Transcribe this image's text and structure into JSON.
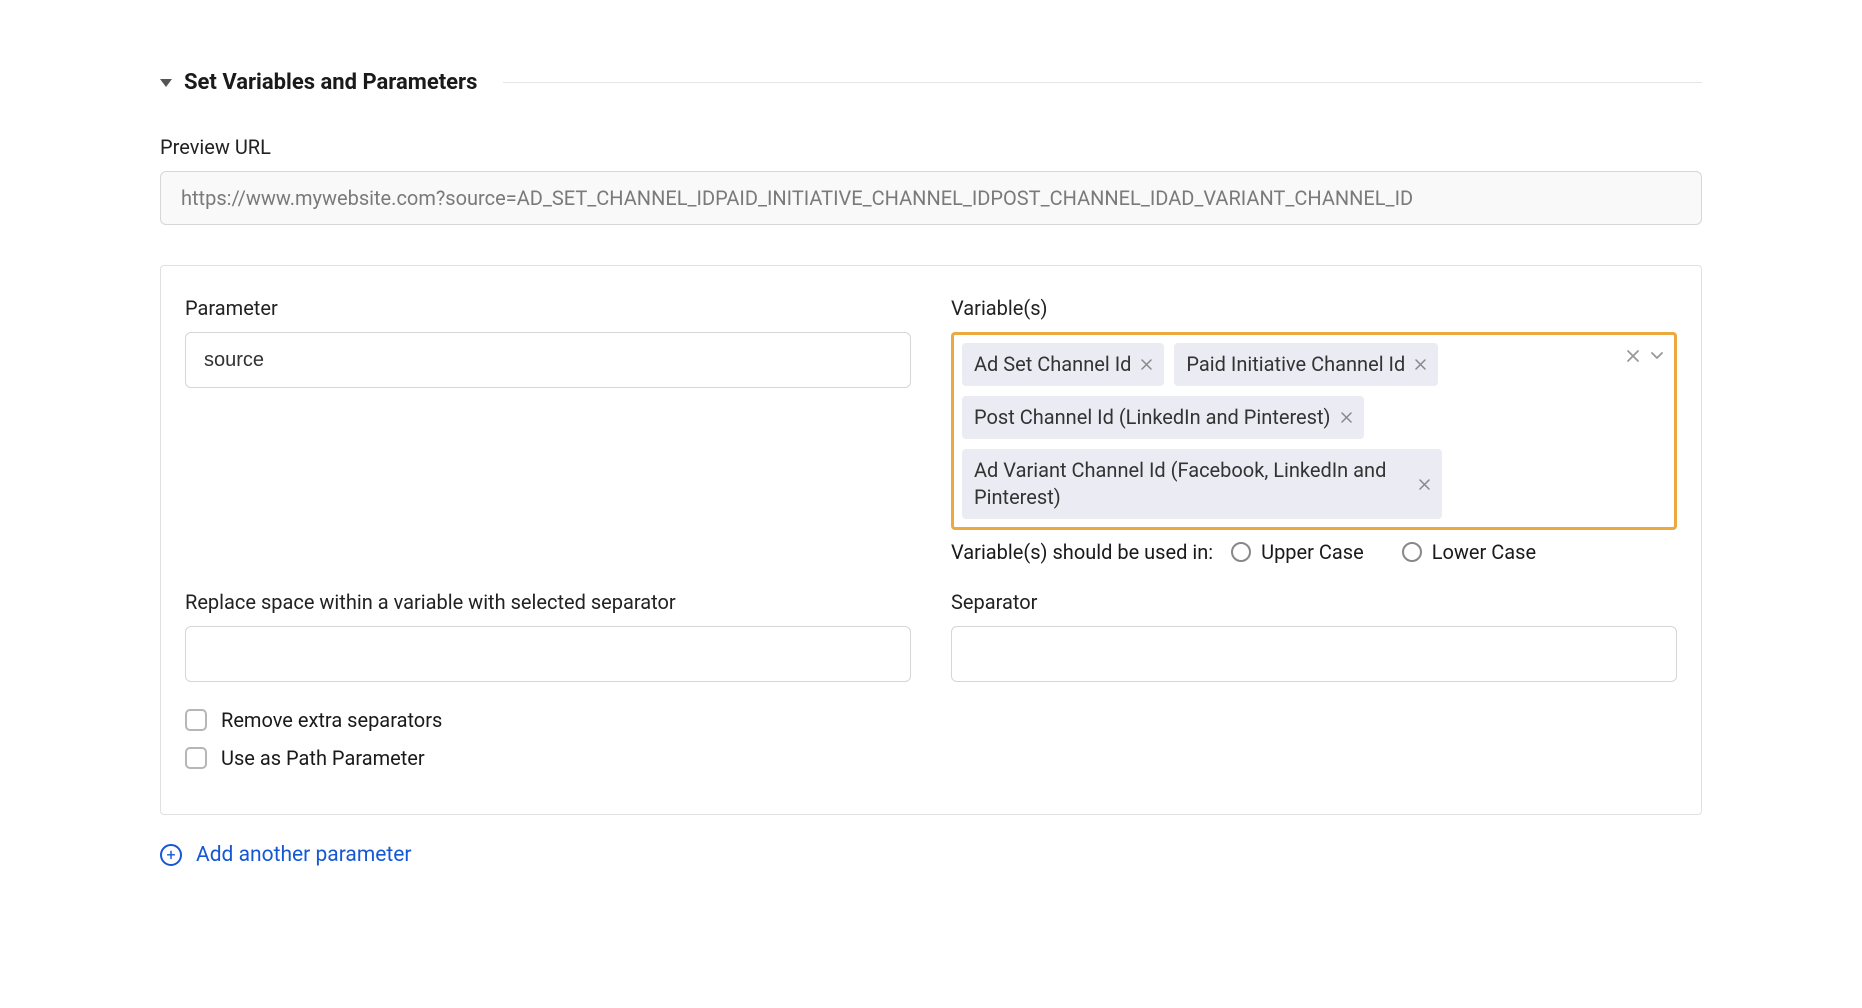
{
  "section": {
    "title": "Set Variables and Parameters"
  },
  "preview": {
    "label": "Preview URL",
    "value": "https://www.mywebsite.com?source=AD_SET_CHANNEL_IDPAID_INITIATIVE_CHANNEL_IDPOST_CHANNEL_IDAD_VARIANT_CHANNEL_ID"
  },
  "param": {
    "label": "Parameter",
    "value": "source"
  },
  "variables": {
    "label": "Variable(s)",
    "chips": [
      "Ad Set Channel Id",
      "Paid Initiative Channel Id",
      "Post Channel Id (LinkedIn and Pinterest)",
      "Ad Variant Channel Id (Facebook, LinkedIn and Pinterest)"
    ],
    "case_label": "Variable(s) should be used in:",
    "case_options": [
      "Upper Case",
      "Lower Case"
    ]
  },
  "replace_space": {
    "label": "Replace space within a variable with selected separator",
    "value": ""
  },
  "separator": {
    "label": "Separator",
    "value": ""
  },
  "options": {
    "remove_extra": "Remove extra separators",
    "path_param": "Use as Path Parameter"
  },
  "add_link": "Add another parameter"
}
